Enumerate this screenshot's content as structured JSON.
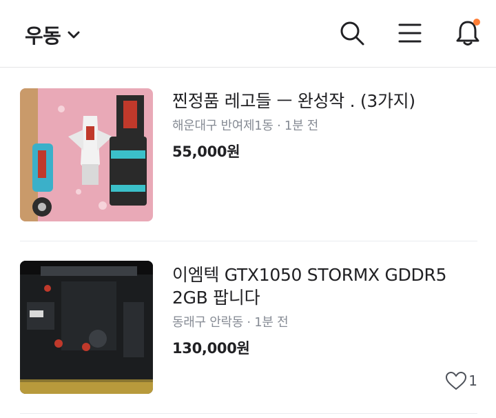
{
  "header": {
    "location": "우동",
    "icons": [
      "chevron-down-icon",
      "search-icon",
      "menu-icon",
      "bell-icon"
    ],
    "accent": "#ff7e36"
  },
  "items": [
    {
      "title": "찐정품  레고들 ㅡ 완성작  .   (3가지)",
      "meta": "해운대구 반여제1동 · 1분 전",
      "price": "55,000원"
    },
    {
      "title": "이엠텍 GTX1050 STORMX GDDR5 2GB 팝니다",
      "meta": "동래구 안락동 · 1분 전",
      "price": "130,000원",
      "likes": "1"
    }
  ]
}
